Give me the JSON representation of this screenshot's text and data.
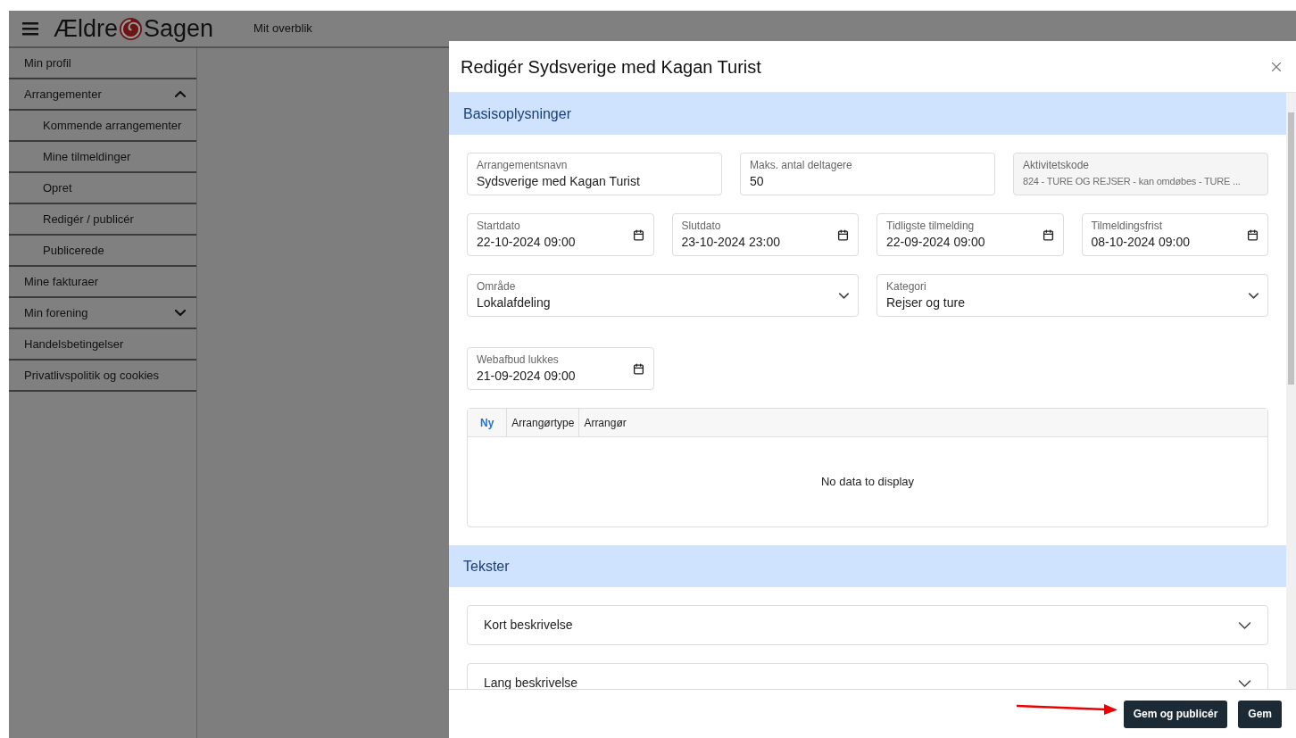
{
  "header": {
    "logo": {
      "left": "Ældre",
      "right": "Sagen"
    },
    "nav": "Mit overblik"
  },
  "sidebar": {
    "items": [
      {
        "label": "Min profil",
        "kind": "link"
      },
      {
        "label": "Arrangementer",
        "kind": "group",
        "expanded": true,
        "children": [
          {
            "label": "Kommende arrangementer"
          },
          {
            "label": "Mine tilmeldinger"
          },
          {
            "label": "Opret"
          },
          {
            "label": "Redigér / publicér"
          },
          {
            "label": "Publicerede"
          }
        ]
      },
      {
        "label": "Mine fakturaer",
        "kind": "link"
      },
      {
        "label": "Min forening",
        "kind": "group",
        "expanded": false
      },
      {
        "label": "Handelsbetingelser",
        "kind": "link"
      },
      {
        "label": "Privatlivspolitik og cookies",
        "kind": "link"
      }
    ]
  },
  "modal": {
    "title": "Redigér Sydsverige med Kagan Turist",
    "sections": [
      {
        "title": "Basisoplysninger",
        "rows": [
          {
            "fields": [
              {
                "kind": "text",
                "label": "Arrangementsnavn",
                "value": "Sydsverige med Kagan Turist",
                "disabled": false
              },
              {
                "kind": "text",
                "label": "Maks. antal deltagere",
                "value": "50",
                "disabled": false
              },
              {
                "kind": "text",
                "label": "Aktivitetskode",
                "value": "824 - TURE OG REJSER - kan omdøbes - TURE ...",
                "disabled": true
              }
            ]
          },
          {
            "fields": [
              {
                "kind": "date",
                "label": "Startdato",
                "value": "22-10-2024 09:00",
                "disabled": false
              },
              {
                "kind": "date",
                "label": "Slutdato",
                "value": "23-10-2024 23:00",
                "disabled": false
              },
              {
                "kind": "date",
                "label": "Tidligste tilmelding",
                "value": "22-09-2024 09:00",
                "disabled": false
              },
              {
                "kind": "date",
                "label": "Tilmeldingsfrist",
                "value": "08-10-2024 09:00",
                "disabled": false
              }
            ]
          },
          {
            "fields": [
              {
                "kind": "select",
                "label": "Område",
                "value": "Lokalafdeling",
                "disabled": false
              },
              {
                "kind": "select",
                "label": "Kategori",
                "value": "Rejser og ture",
                "disabled": false
              }
            ]
          },
          {
            "fields": [
              {
                "kind": "date",
                "label": "Webafbud lukkes",
                "value": "21-09-2024 09:00",
                "disabled": false
              }
            ]
          }
        ],
        "table": {
          "columns": [
            {
              "label": "Ny",
              "kind": "action"
            },
            {
              "label": "Arrangørtype",
              "kind": "header"
            },
            {
              "label": "Arrangør",
              "kind": "header"
            }
          ],
          "empty_text": "No data to display"
        }
      },
      {
        "title": "Tekster",
        "accordions": [
          {
            "label": "Kort beskrivelse",
            "expanded": false
          },
          {
            "label": "Lang beskrivelse",
            "expanded": false
          }
        ]
      }
    ],
    "buttons": [
      "Gem og publicér",
      "Gem"
    ]
  }
}
